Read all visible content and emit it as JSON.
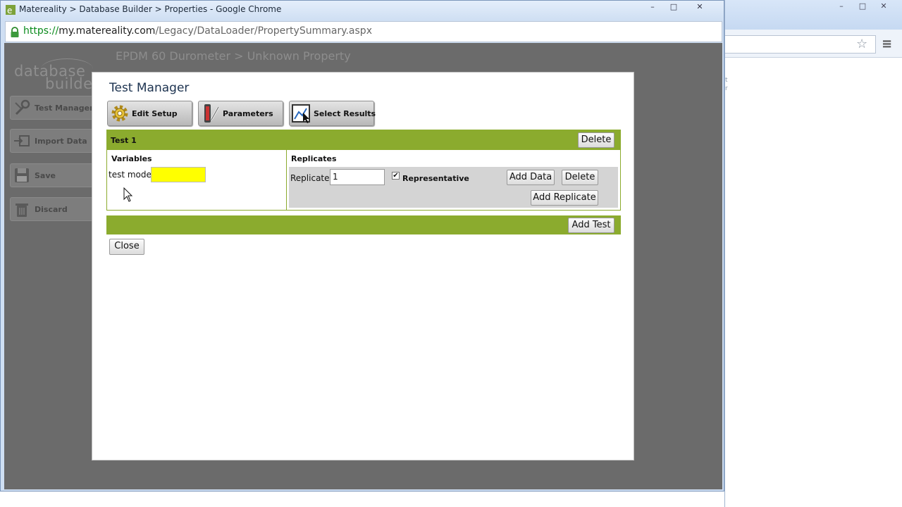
{
  "window": {
    "title": "Matereality > Database Builder > Properties - Google Chrome",
    "url_scheme": "https://",
    "url_host": "my.matereality.com",
    "url_path": "/Legacy/DataLoader/PropertySummary.aspx",
    "controls": {
      "minimize": "–",
      "maximize": "□",
      "close": "✕"
    }
  },
  "background_window": {
    "fragment_1": "t",
    "fragment_2": "r"
  },
  "page": {
    "logo_line1": "database",
    "logo_line2": "builder",
    "breadcrumb": "EPDM 60 Durometer > Unknown Property",
    "sidebar": {
      "items": [
        {
          "label": "Test Manager",
          "icon": "wrench-icon"
        },
        {
          "label": "Import Data",
          "icon": "import-icon"
        },
        {
          "label": "Save",
          "icon": "floppy-disk-icon"
        },
        {
          "label": "Discard",
          "icon": "trash-icon"
        }
      ]
    }
  },
  "modal": {
    "title": "Test Manager",
    "toolbar": {
      "edit_setup": "Edit Setup",
      "parameters": "Parameters",
      "select_results": "Select Results"
    },
    "test": {
      "name": "Test 1",
      "delete_label": "Delete",
      "variables_header": "Variables",
      "replicates_header": "Replicates",
      "variable_label": "test mode",
      "variable_value": "",
      "replicate_label": "Replicate",
      "replicate_value": "1",
      "representative_checked": true,
      "representative_label": "Representative",
      "add_data_label": "Add Data",
      "replicate_delete_label": "Delete",
      "add_replicate_label": "Add Replicate"
    },
    "add_test_label": "Add Test",
    "close_label": "Close"
  },
  "colors": {
    "accent_green": "#8bab2e",
    "highlight_input": "#ffff00",
    "overlay": "#6b6b6b"
  }
}
